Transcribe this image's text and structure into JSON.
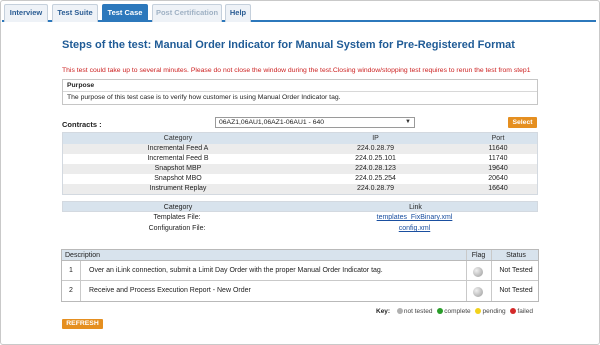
{
  "tabs": [
    {
      "label": "Interview"
    },
    {
      "label": "Test Suite"
    },
    {
      "label": "Test Case"
    },
    {
      "label": "Post Certification"
    },
    {
      "label": "Help"
    }
  ],
  "page": {
    "title": "Steps of the test: Manual Order Indicator for Manual System for Pre-Registered Format",
    "warning": "This test could take up to several minutes. Please do not close the window during the test.Closing window/stopping test requires to rerun the test from step1"
  },
  "purpose": {
    "header": "Purpose",
    "text": "The purpose of this test case is to verify how customer is using Manual Order Indicator tag."
  },
  "contracts": {
    "label": "Contracts :",
    "selected": "06AZ1,06AU1,06AZ1-06AU1 - 640",
    "select_button": "Select"
  },
  "feeds": {
    "headers": [
      "Category",
      "IP",
      "Port"
    ],
    "rows": [
      [
        "Incremental Feed A",
        "224.0.28.79",
        "11640"
      ],
      [
        "Incremental Feed B",
        "224.0.25.101",
        "11740"
      ],
      [
        "Snapshot MBP",
        "224.0.28.123",
        "19640"
      ],
      [
        "Snapshot MBO",
        "224.0.25.254",
        "20640"
      ],
      [
        "Instrument Replay",
        "224.0.28.79",
        "16640"
      ]
    ]
  },
  "files": {
    "headers": [
      "Category",
      "Link"
    ],
    "rows": [
      [
        "Templates File:",
        "templates_FixBinary.xml"
      ],
      [
        "Configuration File:",
        "config.xml"
      ]
    ]
  },
  "steps": {
    "headers": {
      "description": "Description",
      "flag": "Flag",
      "status": "Status"
    },
    "rows": [
      {
        "num": "1",
        "text": "Over an iLink connection, submit a Limit Day Order with the proper Manual Order Indicator tag.",
        "status": "Not Tested"
      },
      {
        "num": "2",
        "text": "Receive and Process Execution Report - New Order",
        "status": "Not Tested"
      }
    ]
  },
  "key": {
    "label": "Key:",
    "items": [
      {
        "label": "not tested",
        "color": "#b0b0b0"
      },
      {
        "label": "complete",
        "color": "#2a9d2a"
      },
      {
        "label": "pending",
        "color": "#f2d21b"
      },
      {
        "label": "failed",
        "color": "#d42a2a"
      }
    ]
  },
  "refresh_button": "REFRESH",
  "colors": {
    "accent": "#2c78bc",
    "title": "#1f5b96",
    "warning": "#cc1f1f",
    "button": "#e58f20"
  }
}
